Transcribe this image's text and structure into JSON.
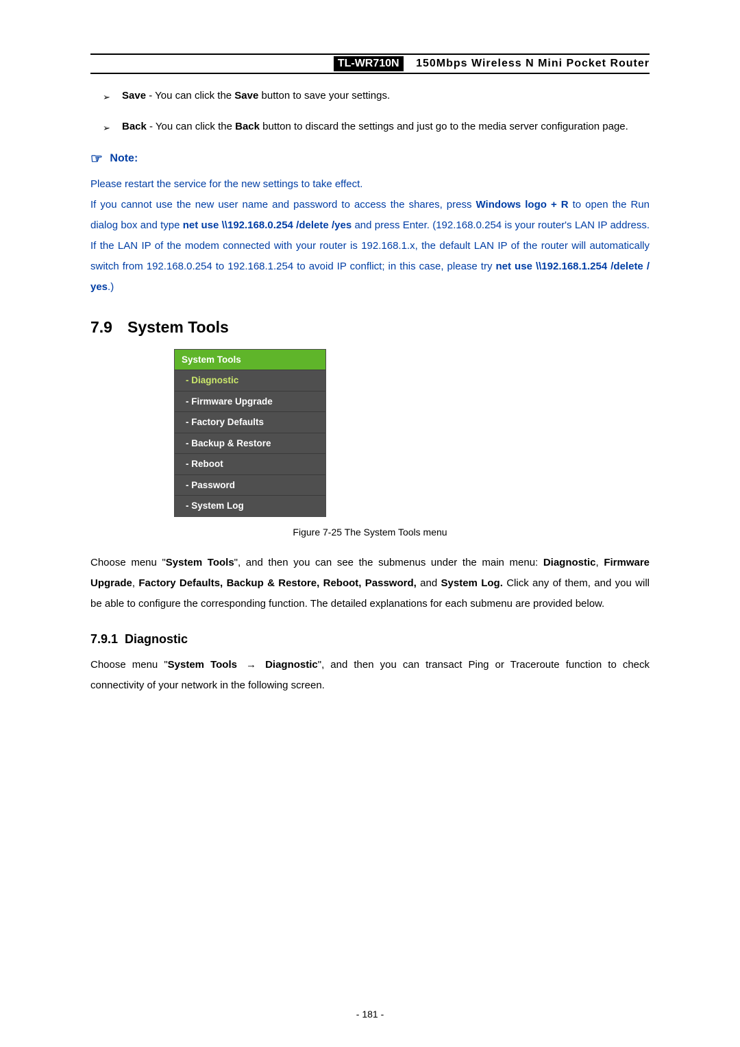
{
  "header": {
    "model": "TL-WR710N",
    "desc": "150Mbps Wireless N Mini Pocket Router"
  },
  "bullets": [
    {
      "lead": "Save",
      "rest": " - You can click the ",
      "bold2": "Save",
      "tail": " button to save your settings."
    },
    {
      "lead": "Back",
      "rest": " - You can click the ",
      "bold2": "Back",
      "tail": " button to discard the settings and just go to the media server configuration page."
    }
  ],
  "note": {
    "label": "Note:",
    "line1": "Please restart the service for the new settings to take effect.",
    "line2a": "If you cannot use the new user name and password to access the shares, press ",
    "winlogo": "Windows logo + R",
    "line2b": " to open the Run dialog box and type ",
    "cmd1": "net use \\\\192.168.0.254 /delete /yes",
    "line2c": " and press Enter. (192.168.0.254 is your router's LAN IP address. If the LAN IP of the modem connected with your router is 192.168.1.x, the default LAN IP of the router will automatically switch from 192.168.0.254 to 192.168.1.254 to avoid IP conflict; in this case, please try ",
    "cmd2": "net use \\\\192.168.1.254 /delete / yes",
    "line2d": ".)"
  },
  "section": {
    "num": "7.9",
    "title": "System Tools"
  },
  "menu": {
    "title": "System Tools",
    "items": [
      {
        "label": "Diagnostic",
        "active": true
      },
      {
        "label": "Firmware Upgrade",
        "active": false
      },
      {
        "label": "Factory Defaults",
        "active": false
      },
      {
        "label": "Backup & Restore",
        "active": false
      },
      {
        "label": "Reboot",
        "active": false
      },
      {
        "label": "Password",
        "active": false
      },
      {
        "label": "System Log",
        "active": false
      }
    ]
  },
  "figure_caption": "Figure 7-25 The System Tools menu",
  "para1": {
    "a": "Choose menu \"",
    "b": "System Tools",
    "c": "\", and then you can see the submenus under the main menu: ",
    "d": "Diagnostic",
    "d2": ", ",
    "e": "Firmware Upgrade",
    "e2": ", ",
    "f": "Factory Defaults, Backup & Restore, Reboot, Password,",
    "g": " and ",
    "h": "System Log.",
    "i": " Click any of them, and you will be able to configure the corresponding function. The detailed explanations for each submenu are provided below."
  },
  "subsection": {
    "num": "7.9.1",
    "title": "Diagnostic"
  },
  "para2": {
    "a": "Choose menu \"",
    "b": "System Tools",
    "arrow": "→",
    "c": "Diagnostic",
    "d": "\", and then you can transact Ping or Traceroute function to check connectivity of your network in the following screen."
  },
  "page_number": "- 181 -"
}
